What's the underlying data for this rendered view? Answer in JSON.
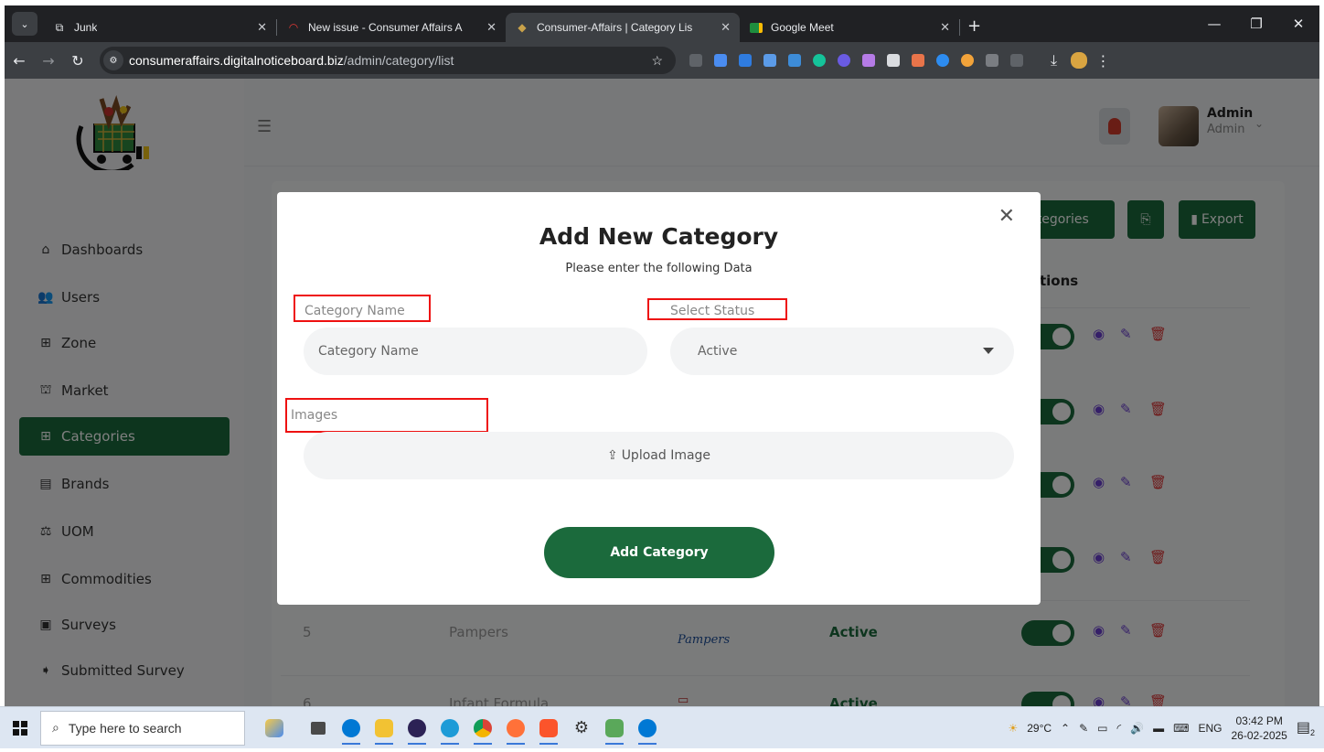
{
  "browser": {
    "tabs": [
      {
        "label": "Junk",
        "active": false
      },
      {
        "label": "New issue - Consumer Affairs A",
        "active": false
      },
      {
        "label": "Consumer-Affairs | Category Lis",
        "active": true
      },
      {
        "label": "Google Meet",
        "active": false
      }
    ],
    "url_host": "consumeraffairs.digitalnoticeboard.biz",
    "url_path": "/admin/category/list"
  },
  "sidebar": {
    "items": [
      {
        "label": "Dashboards",
        "icon": "home-icon"
      },
      {
        "label": "Users",
        "icon": "users-icon"
      },
      {
        "label": "Zone",
        "icon": "grid-icon"
      },
      {
        "label": "Market",
        "icon": "store-icon"
      },
      {
        "label": "Categories",
        "icon": "grid-icon",
        "active": true
      },
      {
        "label": "Brands",
        "icon": "clipboard-icon"
      },
      {
        "label": "UOM",
        "icon": "scale-icon"
      },
      {
        "label": "Commodities",
        "icon": "grid-icon"
      },
      {
        "label": "Surveys",
        "icon": "survey-icon"
      },
      {
        "label": "Submitted Survey",
        "icon": "submitted-icon"
      }
    ]
  },
  "header": {
    "user_name": "Admin",
    "user_role": "Admin"
  },
  "toolbar": {
    "categories_label": "ategories",
    "export_label": "Export"
  },
  "table": {
    "actions_header": "tions",
    "rows": [
      {
        "index": "5",
        "name": "Pampers",
        "logo": "Pampers",
        "status": "Active"
      },
      {
        "index": "6",
        "name": "Infant Formula",
        "logo": "",
        "status": "Active"
      }
    ]
  },
  "modal": {
    "title": "Add New Category",
    "subtitle": "Please enter the following Data",
    "category_label": "Category Name",
    "category_placeholder": "Category Name",
    "status_label": "Select Status",
    "status_value": "Active",
    "images_label": "Images",
    "upload_label": "Upload Image",
    "submit_label": "Add Category"
  },
  "taskbar": {
    "search_placeholder": "Type here to search",
    "weather": "29°C",
    "language": "ENG",
    "time": "03:42 PM",
    "date": "26-02-2025",
    "notifications": "2"
  },
  "colors": {
    "brand_green": "#1b6a3c",
    "highlight_red": "#e11111"
  }
}
